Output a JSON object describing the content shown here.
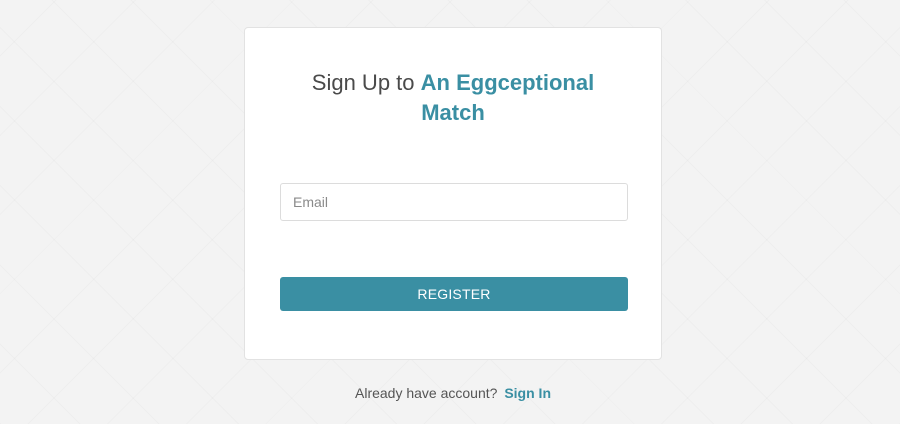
{
  "signup_card": {
    "title_prefix": "Sign Up to",
    "title_brand": "An Eggceptional Match",
    "email": {
      "placeholder": "Email",
      "value": ""
    },
    "register_label": "REGISTER"
  },
  "footer": {
    "prompt": "Already have account?",
    "signin_label": "Sign In"
  },
  "colors": {
    "accent": "#3a8fa3",
    "background": "#f3f3f3",
    "card": "#ffffff"
  }
}
